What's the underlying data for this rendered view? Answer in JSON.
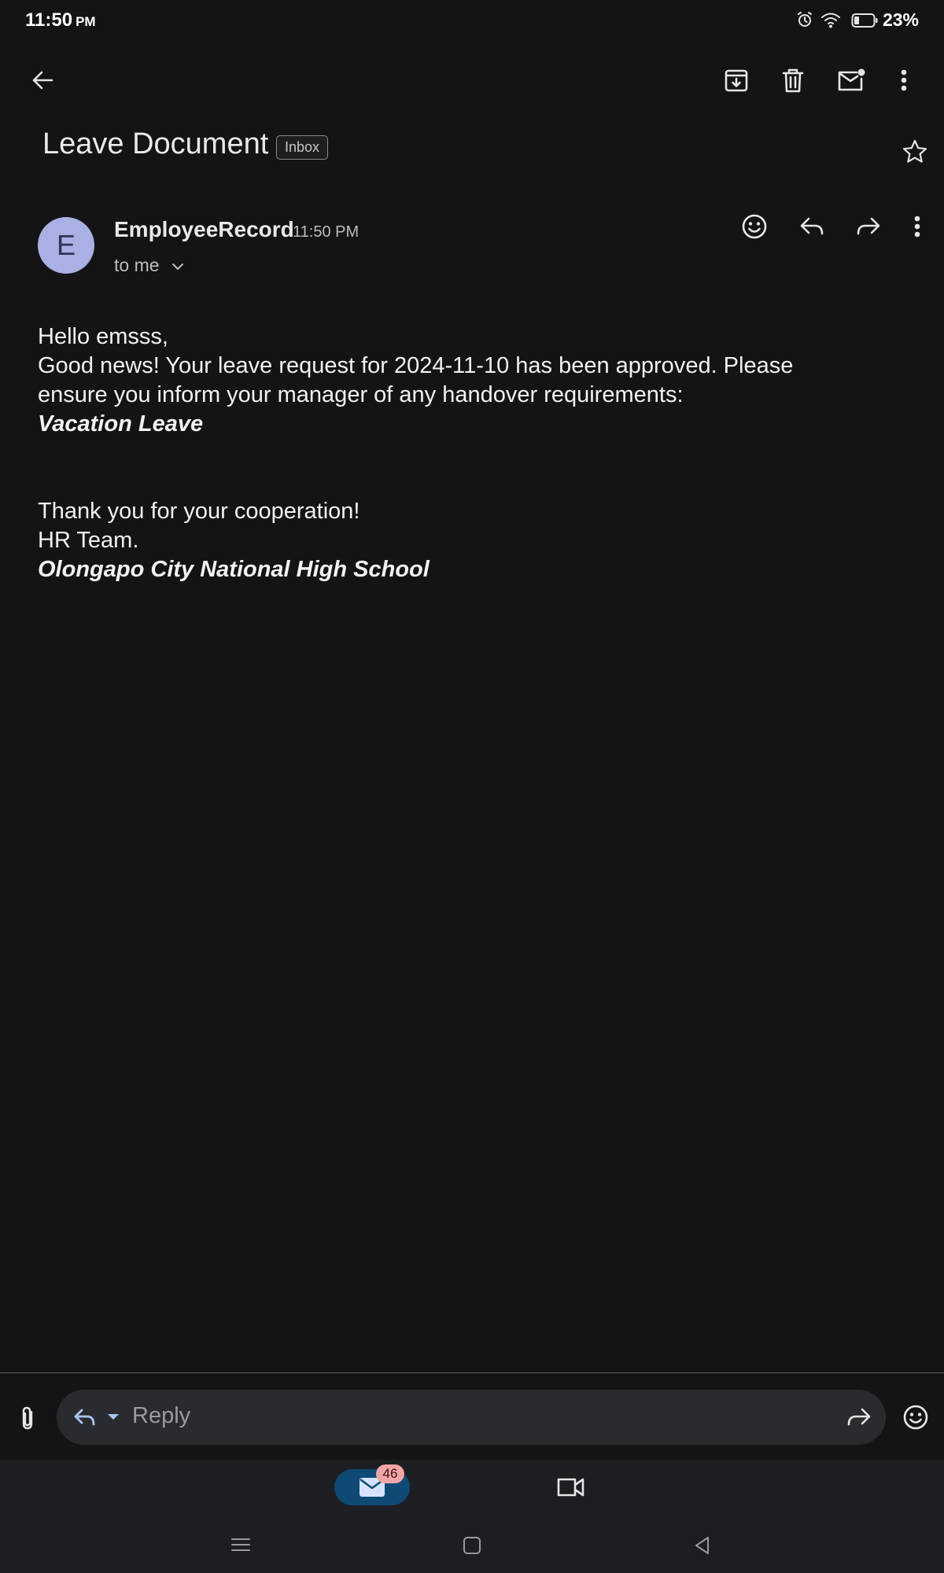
{
  "status_bar": {
    "time": "11:50",
    "ampm": "PM",
    "battery": "23%",
    "icons": [
      "alarm-icon",
      "wifi-icon",
      "battery-icon"
    ]
  },
  "toolbar": {
    "icons": [
      "back-arrow-icon",
      "archive-icon",
      "trash-icon",
      "mark-unread-icon",
      "more-vert-icon"
    ]
  },
  "email": {
    "subject": "Leave Document",
    "label": "Inbox",
    "sender_initial": "E",
    "sender": "EmployeeRecord",
    "time": "11:50 PM",
    "recipient": "to me",
    "body": {
      "greeting": "Hello emsss,",
      "line1": "Good news! Your leave request for 2024-11-10 has been approved. Please",
      "line2": "ensure you inform your manager of any handover requirements:",
      "leave_type": "Vacation Leave",
      "thanks": "Thank you for your cooperation!",
      "team": "HR Team.",
      "school": "Olongapo City National High School"
    }
  },
  "reply_bar": {
    "placeholder": "Reply"
  },
  "bottom_nav": {
    "mail_badge": "46"
  },
  "colors": {
    "background": "#141416",
    "avatar": "#a8b0e4",
    "mail_pill": "#0e4a73",
    "badge": "#f1a6a6"
  }
}
